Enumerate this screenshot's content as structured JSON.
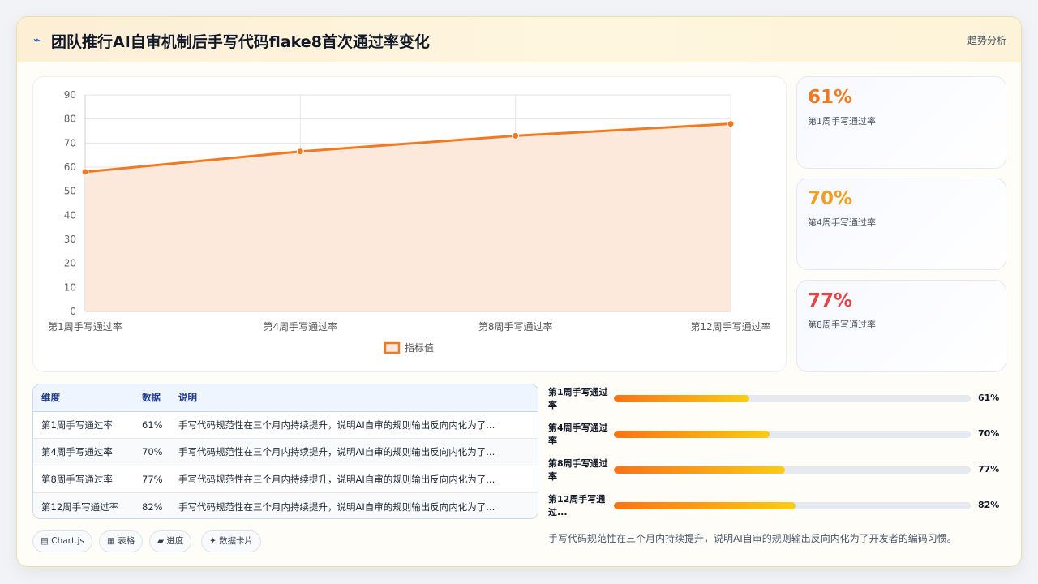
{
  "header": {
    "icon": "flash-icon",
    "title": "团队推行AI自审机制后手写代码flake8首次通过率变化",
    "tag": "趋势分析"
  },
  "chart_data": {
    "type": "line",
    "categories": [
      "第1周手写通过率",
      "第4周手写通过率",
      "第8周手写通过率",
      "第12周手写通过率"
    ],
    "series": [
      {
        "name": "指标值",
        "values": [
          58,
          66.5,
          73,
          78
        ],
        "color": "#f07a22",
        "fill": "#fde8dc"
      }
    ],
    "title": "",
    "xlabel": "",
    "ylabel": "",
    "ylim": [
      0,
      90
    ],
    "yticks": [
      0,
      10,
      20,
      30,
      40,
      50,
      60,
      70,
      80,
      90
    ],
    "grid": true,
    "legend": "bottom"
  },
  "kpis": [
    {
      "value": "61%",
      "label": "第1周手写通过率",
      "color": "#f07a22"
    },
    {
      "value": "70%",
      "label": "第4周手写通过率",
      "color": "#f0a020"
    },
    {
      "value": "77%",
      "label": "第8周手写通过率",
      "color": "#e04848"
    }
  ],
  "table": {
    "headers": [
      "维度",
      "数据",
      "说明"
    ],
    "rows": [
      [
        "第1周手写通过率",
        "61%",
        "手写代码规范性在三个月内持续提升，说明AI自审的规则输出反向内化为了..."
      ],
      [
        "第4周手写通过率",
        "70%",
        "手写代码规范性在三个月内持续提升，说明AI自审的规则输出反向内化为了..."
      ],
      [
        "第8周手写通过率",
        "77%",
        "手写代码规范性在三个月内持续提升，说明AI自审的规则输出反向内化为了..."
      ],
      [
        "第12周手写通过率",
        "82%",
        "手写代码规范性在三个月内持续提升，说明AI自审的规则输出反向内化为了..."
      ]
    ]
  },
  "chips": [
    "▤ Chart.js",
    "▦ 表格",
    "▰ 进度",
    "✦ 数据卡片"
  ],
  "progress": [
    {
      "label": "第1周手写通过率",
      "value": "61%",
      "fraction": 0.38
    },
    {
      "label": "第4周手写通过率",
      "value": "70%",
      "fraction": 0.436
    },
    {
      "label": "第8周手写通过率",
      "value": "77%",
      "fraction": 0.48
    },
    {
      "label": "第12周手写通过...",
      "value": "82%",
      "fraction": 0.51
    }
  ],
  "summary": "手写代码规范性在三个月内持续提升，说明AI自审的规则输出反向内化为了开发者的编码习惯。"
}
